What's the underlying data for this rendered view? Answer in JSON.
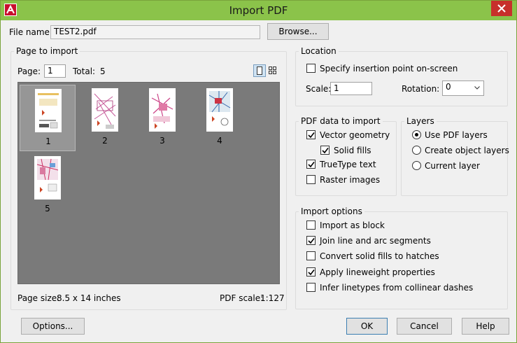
{
  "window": {
    "title": "Import PDF",
    "logo_icon": "autocad-logo-icon",
    "close_icon": "close-icon"
  },
  "file": {
    "label": "File name:",
    "value": "TEST2.pdf",
    "browse": "Browse..."
  },
  "page_to_import": {
    "title": "Page to import",
    "page_label": "Page:",
    "page_value": "1",
    "total_label": "Total:",
    "total_value": "5",
    "pages": [
      "1",
      "2",
      "3",
      "4",
      "5"
    ],
    "selected_page": "1",
    "page_size_label": "Page size:",
    "page_size_value": "8.5 x 14 inches",
    "pdf_scale_label": "PDF scale:",
    "pdf_scale_value": "1:127"
  },
  "location": {
    "title": "Location",
    "specify": {
      "label": "Specify insertion point on-screen",
      "checked": false
    },
    "scale_label": "Scale:",
    "scale_value": "1",
    "rotation_label": "Rotation:",
    "rotation_value": "0"
  },
  "pdf_data": {
    "title": "PDF data to import",
    "items": [
      {
        "label": "Vector geometry",
        "checked": true
      },
      {
        "label": "Solid fills",
        "checked": true
      },
      {
        "label": "TrueType text",
        "checked": true
      },
      {
        "label": "Raster images",
        "checked": false
      }
    ]
  },
  "layers": {
    "title": "Layers",
    "items": [
      {
        "label": "Use PDF layers",
        "selected": true
      },
      {
        "label": "Create object layers",
        "selected": false
      },
      {
        "label": "Current layer",
        "selected": false
      }
    ]
  },
  "import_options": {
    "title": "Import options",
    "items": [
      {
        "label": "Import as block",
        "checked": false
      },
      {
        "label": "Join line and arc segments",
        "checked": true
      },
      {
        "label": "Convert solid fills to hatches",
        "checked": false
      },
      {
        "label": "Apply lineweight properties",
        "checked": true
      },
      {
        "label": "Infer linetypes from collinear dashes",
        "checked": false
      }
    ]
  },
  "buttons": {
    "options": "Options...",
    "ok": "OK",
    "cancel": "Cancel",
    "help": "Help"
  },
  "colors": {
    "titlebar": "#8bc34a",
    "close": "#c7302b",
    "preview_bg": "#7a7a7a"
  }
}
